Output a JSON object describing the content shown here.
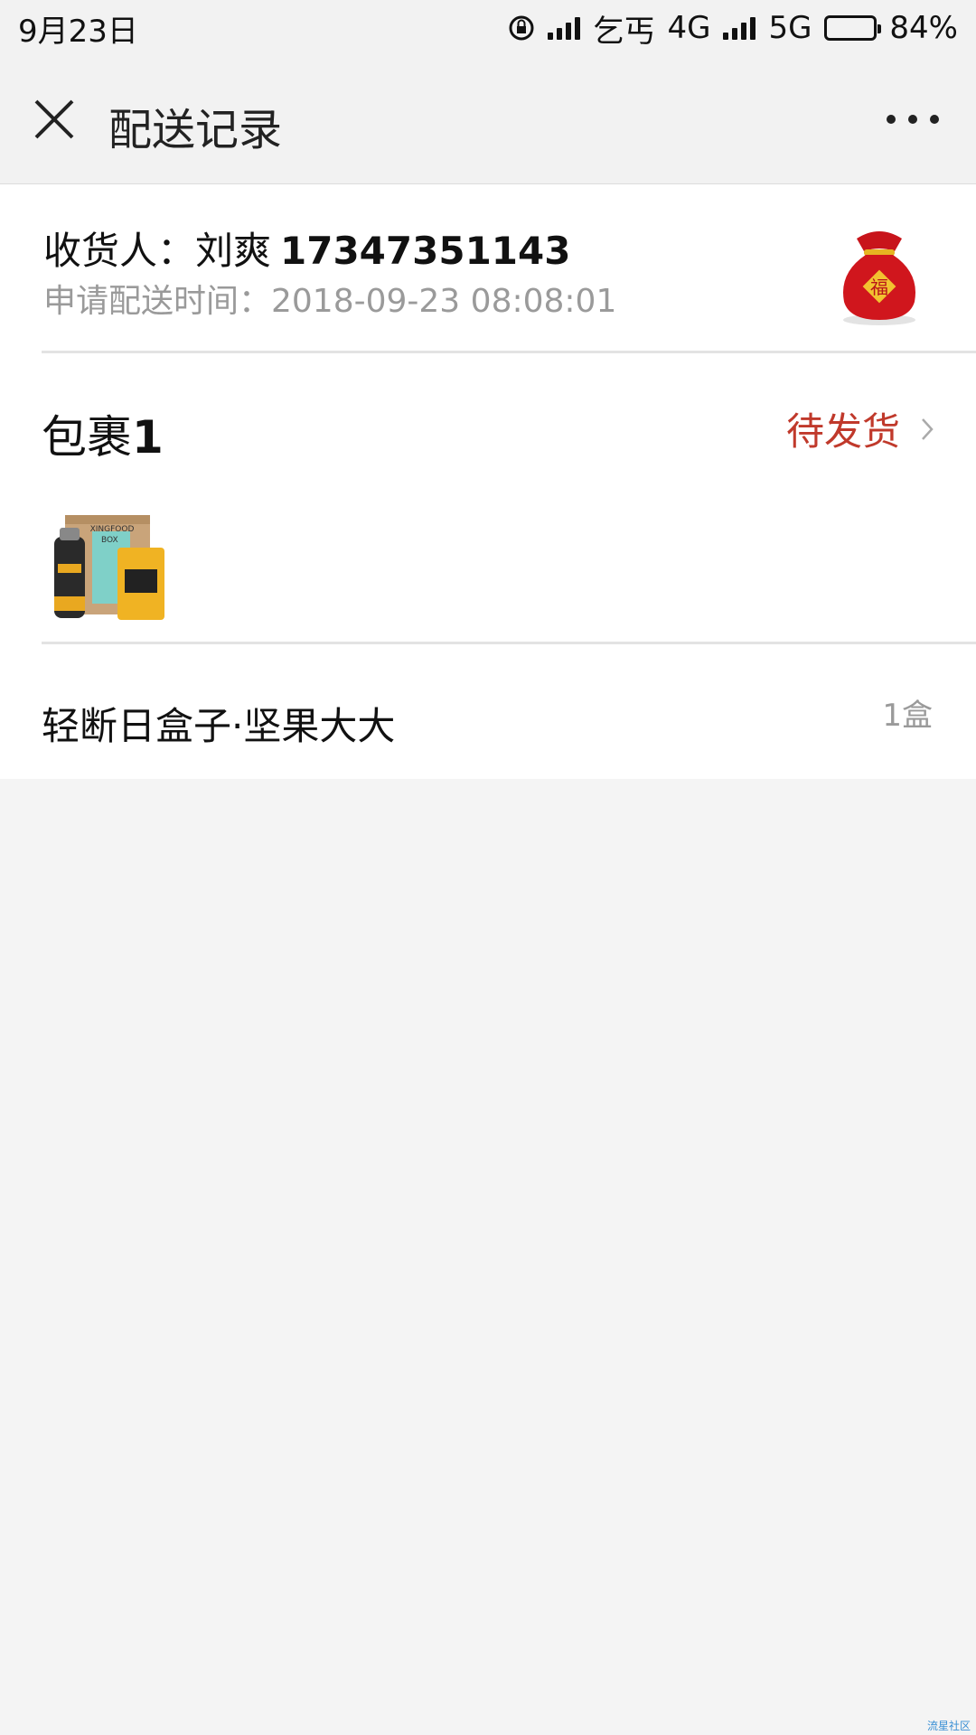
{
  "status_bar": {
    "time": "9月23日",
    "carrier_text": "乞丐",
    "net1": "4G",
    "net2": "5G",
    "battery_level": 0.84,
    "battery_text": "84%"
  },
  "nav": {
    "title": "配送记录"
  },
  "receiver": {
    "label": "收货人：刘爽",
    "phone": "17347351143",
    "apply_time": "申请配送时间：2018-09-23 08:08:01"
  },
  "package": {
    "title_prefix": "包裹",
    "title_num": "1",
    "status": "待发货",
    "status_color": "#c0392b"
  },
  "item": {
    "name": "轻断日盒子·坚果大大",
    "qty": "1盒",
    "image_labels": [
      "XINGFOOD",
      "BOX"
    ]
  },
  "watermark": "流星社区"
}
